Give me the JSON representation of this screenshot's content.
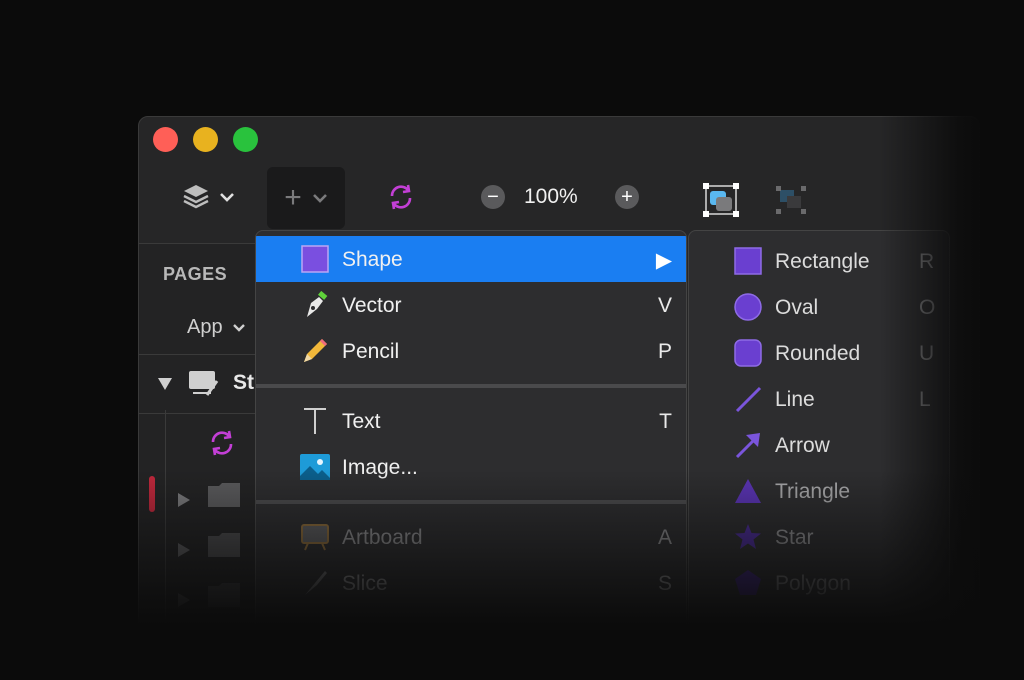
{
  "toolbar": {
    "zoom_value": "100%",
    "zoom_out_symbol": "−",
    "zoom_in_symbol": "+",
    "insert_symbol": "+",
    "icons": [
      "layers-icon",
      "chevron-down-icon",
      "insert-icon",
      "sync-icon",
      "zoom-out-icon",
      "zoom-in-icon",
      "mask-icon",
      "group-icon"
    ]
  },
  "sidebar": {
    "pages_title": "PAGES",
    "page_dropdown": "App",
    "layer_name": "St"
  },
  "insert_menu": {
    "items": [
      {
        "label": "Shape",
        "shortcut": "▶",
        "icon": "shape-square-icon",
        "selected": true
      },
      {
        "label": "Vector",
        "shortcut": "V",
        "icon": "pen-icon"
      },
      {
        "label": "Pencil",
        "shortcut": "P",
        "icon": "pencil-icon"
      },
      {
        "label": "Text",
        "shortcut": "T",
        "icon": "text-icon"
      },
      {
        "label": "Image...",
        "shortcut": "",
        "icon": "image-icon"
      },
      {
        "label": "Artboard",
        "shortcut": "A",
        "icon": "artboard-icon"
      },
      {
        "label": "Slice",
        "shortcut": "S",
        "icon": "slice-icon"
      }
    ]
  },
  "shape_submenu": {
    "items": [
      {
        "label": "Rectangle",
        "shortcut": "R",
        "icon": "rectangle-icon"
      },
      {
        "label": "Oval",
        "shortcut": "O",
        "icon": "oval-icon"
      },
      {
        "label": "Rounded",
        "shortcut": "U",
        "icon": "rounded-rectangle-icon"
      },
      {
        "label": "Line",
        "shortcut": "L",
        "icon": "line-icon"
      },
      {
        "label": "Arrow",
        "shortcut": "",
        "icon": "arrow-icon"
      },
      {
        "label": "Triangle",
        "shortcut": "",
        "icon": "triangle-icon"
      },
      {
        "label": "Star",
        "shortcut": "",
        "icon": "star-icon"
      },
      {
        "label": "Polygon",
        "shortcut": "",
        "icon": "polygon-icon"
      }
    ]
  },
  "colors": {
    "accent_selected": "#1a7ef2",
    "shape_purple": "#6a3fd0",
    "sync_magenta": "#c33fd6",
    "page_indicator": "#c0283c"
  }
}
